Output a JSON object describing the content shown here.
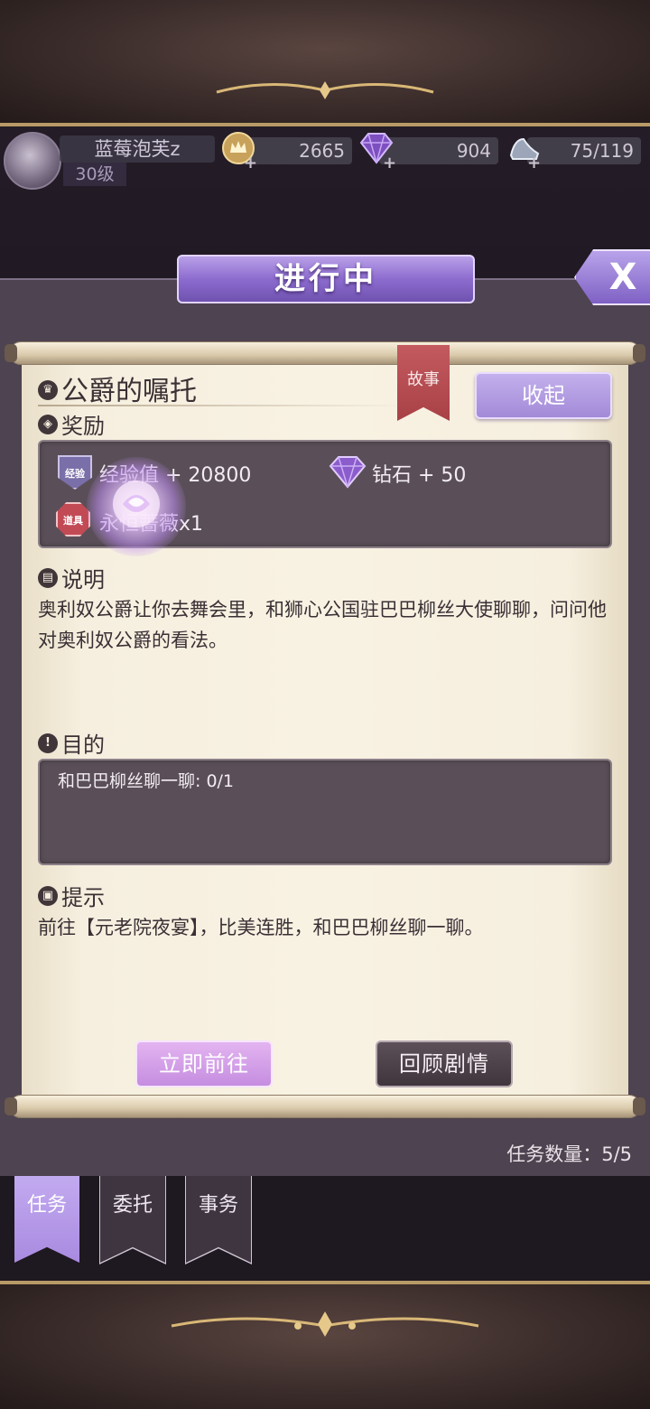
{
  "player": {
    "name": "蓝莓泡芙z",
    "level": "30级"
  },
  "resources": {
    "gold": "2665",
    "diamond": "904",
    "stamina": "75/119"
  },
  "panel": {
    "title": "进行中",
    "close_label": "X"
  },
  "quest": {
    "ribbon": "故事",
    "title": "公爵的嘱托",
    "collapse_label": "收起",
    "rewards_heading": "奖励",
    "rewards": {
      "exp_tag": "经验",
      "exp_text": "经验值 + 20800",
      "diamond_text": "钻石 + 50",
      "item_tag": "道具",
      "item_text": "永恒蔷薇x1"
    },
    "desc_heading": "说明",
    "description": "奥利奴公爵让你去舞会里，和狮心公国驻巴巴柳丝大使聊聊，问问他对奥利奴公爵的看法。",
    "goal_heading": "目的",
    "goal": "和巴巴柳丝聊一聊: 0/1",
    "hint_heading": "提示",
    "hint": "前往【元老院夜宴】，比美连胜，和巴巴柳丝聊一聊。",
    "go_label": "立即前往",
    "review_label": "回顾剧情"
  },
  "task_count": "任务数量：5/5",
  "tabs": [
    {
      "label": "任务",
      "active": true
    },
    {
      "label": "委托",
      "active": false
    },
    {
      "label": "事务",
      "active": false
    }
  ],
  "colors": {
    "accent": "#a98ae0",
    "ribbon": "#b84c52",
    "paper": "#f6efdf"
  }
}
